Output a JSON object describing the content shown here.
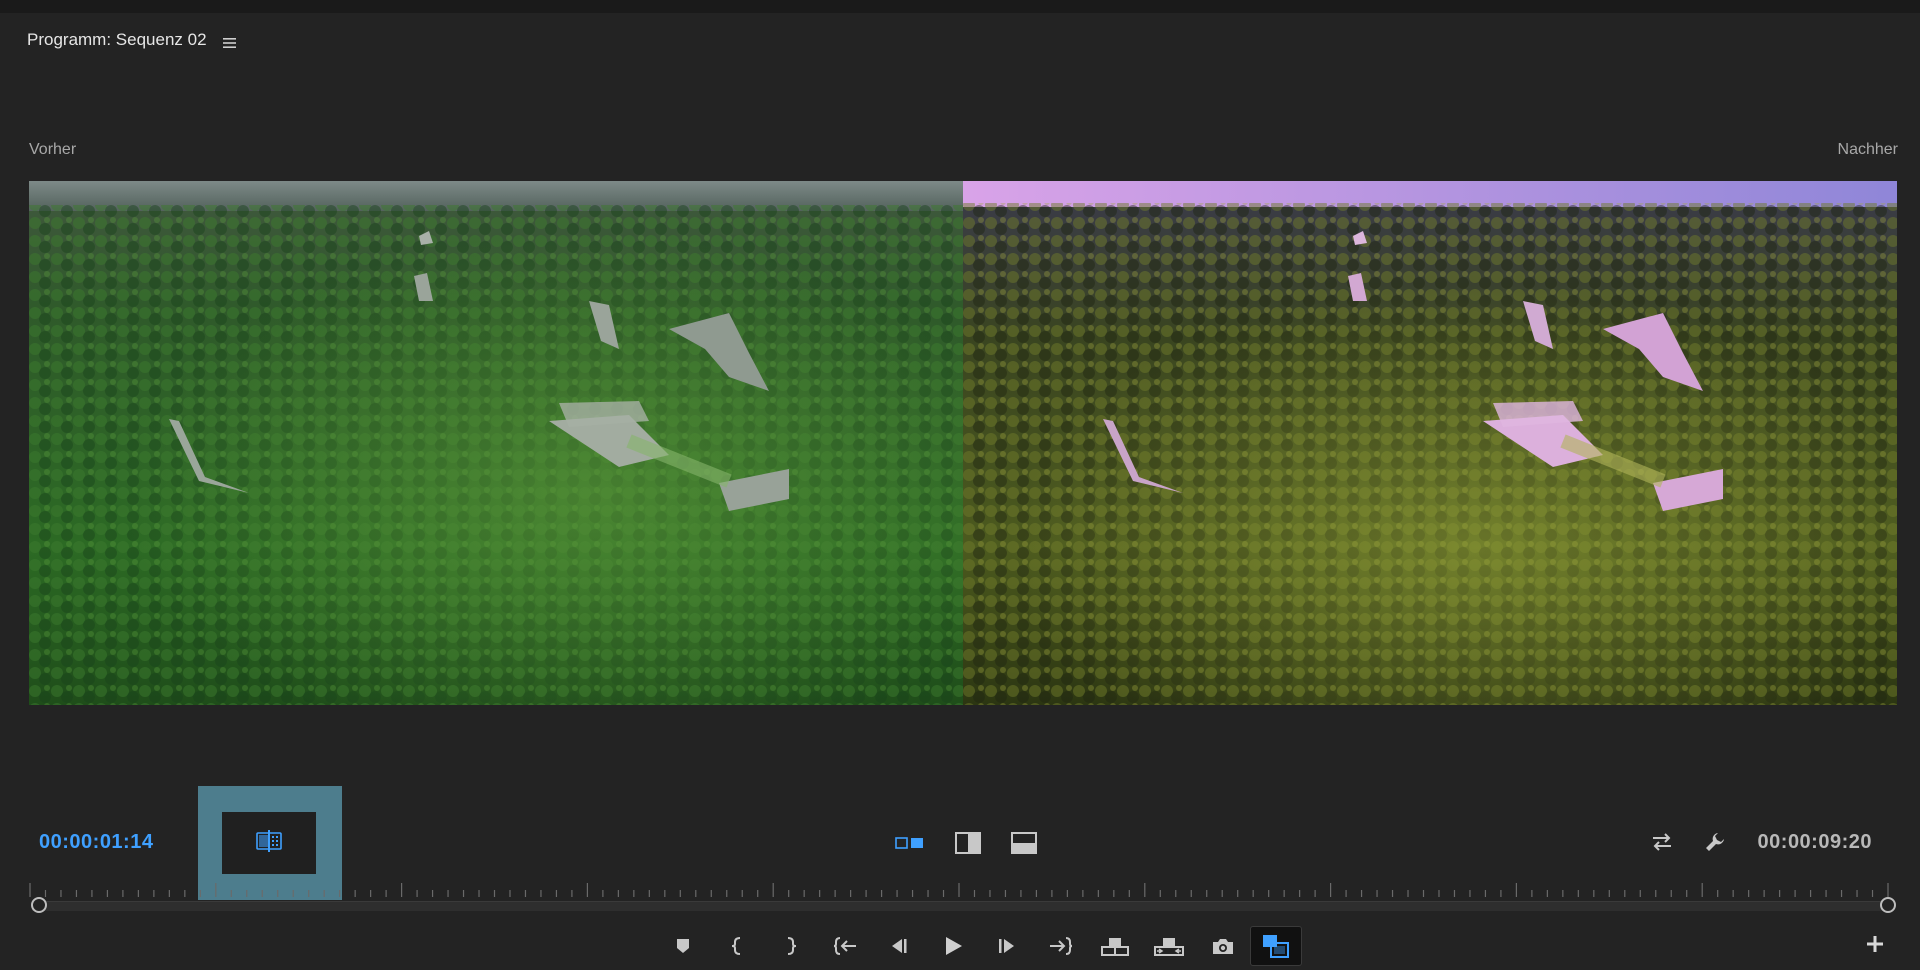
{
  "panel": {
    "title": "Programm: Sequenz 02",
    "menu_icon": "hamburger-menu-icon"
  },
  "monitor": {
    "before_label": "Vorher",
    "after_label": "Nachher"
  },
  "timecodes": {
    "current": "00:00:01:14",
    "duration": "00:00:09:20",
    "current_color": "#3fa0ff"
  },
  "view_modes": [
    {
      "name": "side-by-side-icon",
      "active": true
    },
    {
      "name": "vertical-split-icon",
      "active": false
    },
    {
      "name": "horizontal-split-icon",
      "active": false
    }
  ],
  "highlighted_tool": "shuffle-split-icon",
  "right_tools": [
    "swap-sides-icon",
    "wrench-icon"
  ],
  "transport": [
    "marker-icon",
    "mark-in-icon",
    "mark-out-icon",
    "go-to-in-icon",
    "step-back-icon",
    "play-icon",
    "step-forward-icon",
    "go-to-out-icon",
    "lift-icon",
    "extract-icon",
    "export-frame-icon",
    "comparison-view-icon"
  ],
  "transport_active": "comparison-view-icon",
  "colors": {
    "accent": "#3fa0ff",
    "highlight": "#4d7d8d",
    "panel_bg": "#232323"
  }
}
